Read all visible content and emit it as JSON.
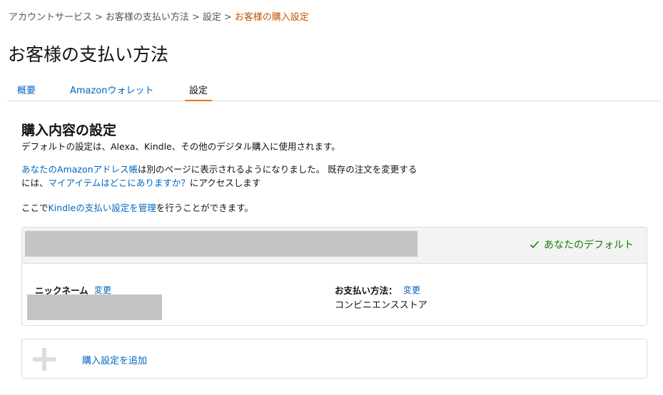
{
  "breadcrumb": {
    "items": [
      "アカウントサービス",
      "お客様の支払い方法",
      "設定"
    ],
    "current": "お客様の購入設定",
    "separator": ">"
  },
  "page": {
    "title": "お客様の支払い方法"
  },
  "tabs": [
    {
      "label": "概要",
      "active": false
    },
    {
      "label": "Amazonウォレット",
      "active": false
    },
    {
      "label": "設定",
      "active": true
    }
  ],
  "section": {
    "title": "購入内容の設定",
    "description": "デフォルトの設定は、Alexa、Kindle、その他のデジタル購入に使用されます。",
    "address_link": "あなたのAmazonアドレス帳",
    "address_text_1": "は別のページに表示されるようになりました。 既存の注文を変更する",
    "address_text_2": "には、",
    "items_link": "マイアイテムはどこにありますか？",
    "address_text_3": "にアクセスします",
    "kindle_prefix": "ここで",
    "kindle_link": "Kindleの支払い設定を管理",
    "kindle_suffix": "を行うことができます。"
  },
  "card": {
    "default_label": "あなたのデフォルト",
    "nickname_label": "ニックネーム",
    "nickname_change": "変更",
    "payment_label": "お支払い方法：",
    "payment_change": "変更",
    "payment_value": "コンビニエンスストア"
  },
  "add": {
    "label": "購入設定を追加"
  },
  "colors": {
    "link": "#0066c0",
    "current_crumb": "#c45500",
    "tab_underline": "#e77600",
    "default_green": "#118000",
    "redaction": "#c4c4c4"
  }
}
